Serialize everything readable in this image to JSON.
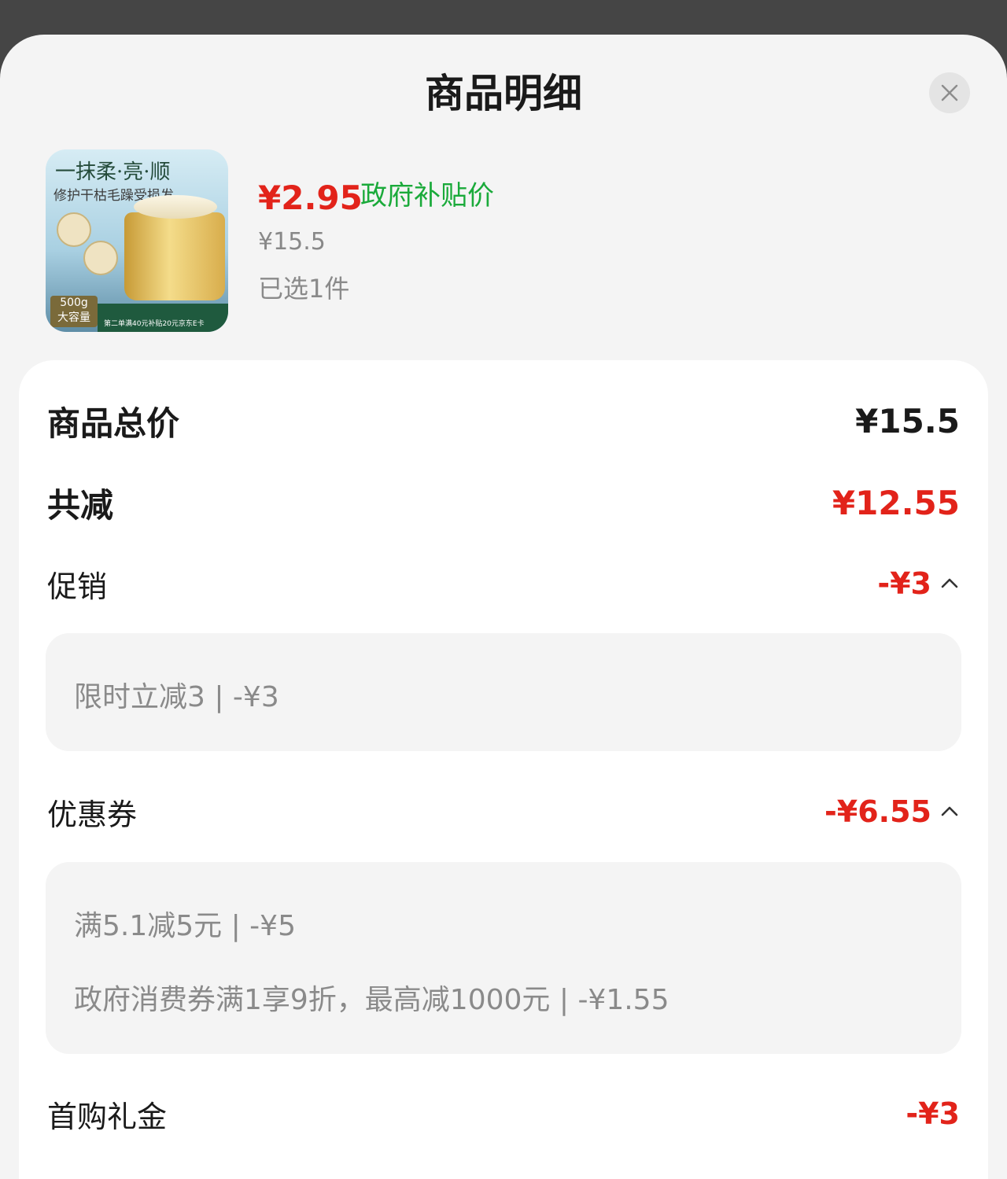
{
  "header": {
    "title": "商品明细"
  },
  "product": {
    "image_text_1": "一抹柔·亮·顺",
    "image_text_2": "修护干枯毛躁受损发",
    "image_weight_1": "500g",
    "image_weight_2": "大容量",
    "image_band_text": "第二单满40元补贴20元京东E卡",
    "price_now": "¥2.95",
    "subsidy_label": "政府补贴价",
    "price_original": "¥15.5",
    "quantity_text": "已选1件"
  },
  "summary": {
    "total_label": "商品总价",
    "total_value": "¥15.5",
    "reduce_label": "共减",
    "reduce_value": "¥12.55"
  },
  "promotion": {
    "label": "促销",
    "value": "-¥3",
    "details": [
      "限时立减3 | -¥3"
    ]
  },
  "coupon": {
    "label": "优惠券",
    "value": "-¥6.55",
    "details": [
      "满5.1减5元 | -¥5",
      "政府消费券满1享9折，最高减1000元 | -¥1.55"
    ]
  },
  "first_purchase": {
    "label": "首购礼金",
    "value": "-¥3"
  },
  "colors": {
    "red": "#e2231a",
    "green": "#1aaa3a"
  }
}
